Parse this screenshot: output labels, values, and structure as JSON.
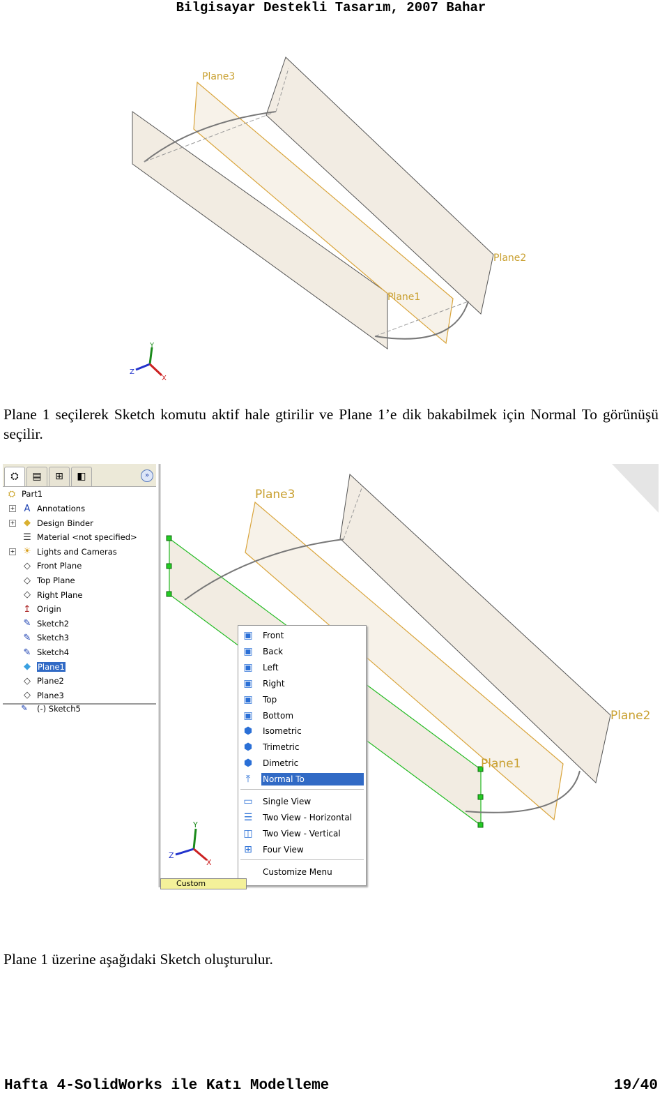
{
  "header": "Bilgisayar Destekli Tasarım, 2007 Bahar",
  "footer": {
    "left": "Hafta 4-SolidWorks ile Katı Modelleme",
    "right": "19/40"
  },
  "paragraph1": "Plane 1 seçilerek Sketch komutu aktif hale gtirilir ve Plane 1’e dik bakabilmek için Normal To görünüşü seçilir.",
  "paragraph2": "Plane 1 üzerine aşağıdaki Sketch oluşturulur.",
  "figure1": {
    "labels": {
      "plane1": "Plane1",
      "plane2": "Plane2",
      "plane3": "Plane3"
    },
    "axes": {
      "x": "X",
      "y": "Y",
      "z": "Z"
    }
  },
  "figure2": {
    "labels": {
      "plane1": "Plane1",
      "plane2": "Plane2",
      "plane3": "Plane3"
    },
    "axes": {
      "x": "X",
      "y": "Y",
      "z": "Z"
    },
    "tree": {
      "root": "Part1",
      "items": [
        {
          "label": "Annotations",
          "icon": "annotations-folder-icon",
          "expandable": true
        },
        {
          "label": "Design Binder",
          "icon": "design-binder-icon",
          "expandable": true
        },
        {
          "label": "Material <not specified>",
          "icon": "material-icon",
          "expandable": false
        },
        {
          "label": "Lights and Cameras",
          "icon": "lights-folder-icon",
          "expandable": true
        },
        {
          "label": "Front Plane",
          "icon": "plane-icon",
          "expandable": false
        },
        {
          "label": "Top Plane",
          "icon": "plane-icon",
          "expandable": false
        },
        {
          "label": "Right Plane",
          "icon": "plane-icon",
          "expandable": false
        },
        {
          "label": "Origin",
          "icon": "origin-icon",
          "expandable": false
        },
        {
          "label": "Sketch2",
          "icon": "sketch-icon",
          "expandable": false
        },
        {
          "label": "Sketch3",
          "icon": "sketch-icon",
          "expandable": false
        },
        {
          "label": "Sketch4",
          "icon": "sketch-icon",
          "expandable": false
        },
        {
          "label": "Plane1",
          "icon": "plane-selected-icon",
          "expandable": false,
          "selected": true
        },
        {
          "label": "Plane2",
          "icon": "plane-icon",
          "expandable": false
        },
        {
          "label": "Plane3",
          "icon": "plane-icon",
          "expandable": false
        },
        {
          "label": "(-) Sketch5",
          "icon": "sketch-icon",
          "expandable": false
        }
      ]
    },
    "menu": {
      "group1": [
        "Front",
        "Back",
        "Left",
        "Right",
        "Top",
        "Bottom",
        "Isometric",
        "Trimetric",
        "Dimetric",
        "Normal To"
      ],
      "highlighted": "Normal To",
      "group2": [
        "Single View",
        "Two View - Horizontal",
        "Two View - Vertical",
        "Four View"
      ],
      "group3": [
        "Customize Menu"
      ]
    },
    "custom_tab": "Custom"
  },
  "colors": {
    "plane_fill": "#f2ece2",
    "plane3_edge": "#d9a43a",
    "selected_edge": "#22bb22",
    "highlight": "#316ac5"
  }
}
